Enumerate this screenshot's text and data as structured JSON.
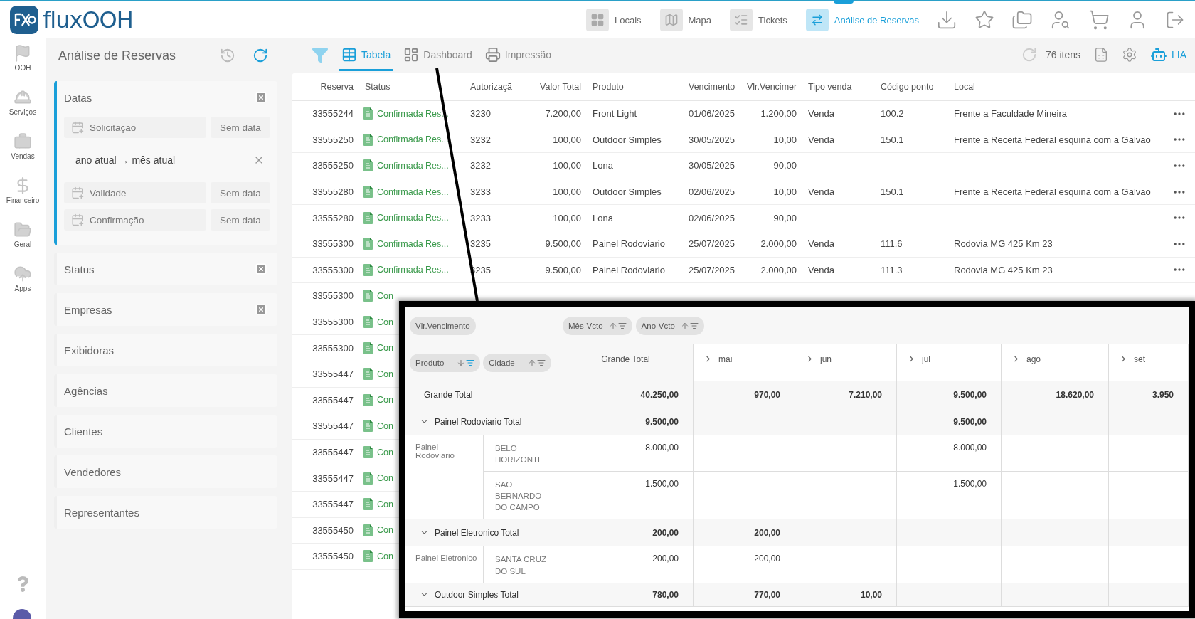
{
  "brand": {
    "name": "fluxOOH"
  },
  "top_nav": [
    {
      "label": "Locais",
      "kind": "grid",
      "selected": false
    },
    {
      "label": "Mapa",
      "kind": "map",
      "selected": false
    },
    {
      "label": "Tickets",
      "kind": "list",
      "selected": false
    },
    {
      "label": "Análise de Reservas",
      "kind": "analysis",
      "selected": true
    }
  ],
  "rail": [
    {
      "label": "OOH",
      "kind": "flag"
    },
    {
      "label": "Serviços",
      "kind": "helmet"
    },
    {
      "label": "Vendas",
      "kind": "briefcase"
    },
    {
      "label": "Financeiro",
      "kind": "money"
    },
    {
      "label": "Geral",
      "kind": "folder"
    },
    {
      "label": "Apps",
      "kind": "cloud"
    }
  ],
  "filter_panel": {
    "title": "Análise de Reservas",
    "sections": [
      {
        "label": "Datas",
        "expanded": true,
        "clearable": true,
        "fields": [
          {
            "kind": "date",
            "label": "Solicitação",
            "value": "Sem data"
          },
          {
            "kind": "range",
            "text": "ano atual → mês atual"
          },
          {
            "kind": "date",
            "label": "Validade",
            "value": "Sem data"
          },
          {
            "kind": "date",
            "label": "Confirmação",
            "value": "Sem data"
          }
        ]
      },
      {
        "label": "Status",
        "expanded": false,
        "clearable": true
      },
      {
        "label": "Empresas",
        "expanded": false,
        "clearable": true
      },
      {
        "label": "Exibidoras",
        "expanded": false,
        "clearable": false
      },
      {
        "label": "Agências",
        "expanded": false,
        "clearable": false
      },
      {
        "label": "Clientes",
        "expanded": false,
        "clearable": false
      },
      {
        "label": "Vendedores",
        "expanded": false,
        "clearable": false
      },
      {
        "label": "Representantes",
        "expanded": false,
        "clearable": false
      }
    ]
  },
  "toolbar": {
    "tabs": [
      {
        "label": "Tabela",
        "kind": "table",
        "selected": true
      },
      {
        "label": "Dashboard",
        "kind": "dashboard",
        "selected": false
      },
      {
        "label": "Impressão",
        "kind": "print",
        "selected": false
      }
    ],
    "count": "76 itens",
    "assistant": "LIA"
  },
  "table": {
    "columns": [
      "Reserva",
      "Status",
      "Autorizaçã",
      "Valor Total",
      "Produto",
      "Vencimento",
      "Vlr.Vencimer",
      "Tipo venda",
      "Código ponto",
      "Local"
    ],
    "rows": [
      {
        "reserva": "33555244",
        "status": "Confirmada Res...",
        "autorizacao": "3230",
        "valor_total": "7.200,00",
        "produto": "Front Light",
        "vencimento": "01/06/2025",
        "vlr_vencimento": "1.200,00",
        "tipo_venda": "Venda",
        "codigo_ponto": "100.2",
        "local": "Frente a Faculdade Mineira"
      },
      {
        "reserva": "33555250",
        "status": "Confirmada Res...",
        "autorizacao": "3232",
        "valor_total": "100,00",
        "produto": "Outdoor Simples",
        "vencimento": "30/05/2025",
        "vlr_vencimento": "10,00",
        "tipo_venda": "Venda",
        "codigo_ponto": "150.1",
        "local": "Frente a Receita Federal esquina com a Galvão"
      },
      {
        "reserva": "33555250",
        "status": "Confirmada Res...",
        "autorizacao": "3232",
        "valor_total": "100,00",
        "produto": "Lona",
        "vencimento": "30/05/2025",
        "vlr_vencimento": "90,00"
      },
      {
        "reserva": "33555280",
        "status": "Confirmada Res...",
        "autorizacao": "3233",
        "valor_total": "100,00",
        "produto": "Outdoor Simples",
        "vencimento": "02/06/2025",
        "vlr_vencimento": "10,00",
        "tipo_venda": "Venda",
        "codigo_ponto": "150.1",
        "local": "Frente a Receita Federal esquina com a Galvão"
      },
      {
        "reserva": "33555280",
        "status": "Confirmada Res...",
        "autorizacao": "3233",
        "valor_total": "100,00",
        "produto": "Lona",
        "vencimento": "02/06/2025",
        "vlr_vencimento": "90,00"
      },
      {
        "reserva": "33555300",
        "status": "Confirmada Res...",
        "autorizacao": "3235",
        "valor_total": "9.500,00",
        "produto": "Painel Rodoviario",
        "vencimento": "25/07/2025",
        "vlr_vencimento": "2.000,00",
        "tipo_venda": "Venda",
        "codigo_ponto": "111.6",
        "local": "Rodovia MG 425 Km 23"
      },
      {
        "reserva": "33555300",
        "status": "Confirmada Res...",
        "autorizacao": "3235",
        "valor_total": "9.500,00",
        "produto": "Painel Rodoviario",
        "vencimento": "25/07/2025",
        "vlr_vencimento": "2.000,00",
        "tipo_venda": "Venda",
        "codigo_ponto": "111.3",
        "local": "Rodovia MG 425 Km 23"
      },
      {
        "reserva": "33555300",
        "status": "Con"
      },
      {
        "reserva": "33555300",
        "status": "Con"
      },
      {
        "reserva": "33555300",
        "status": "Con"
      },
      {
        "reserva": "33555447",
        "status": "Con"
      },
      {
        "reserva": "33555447",
        "status": "Con"
      },
      {
        "reserva": "33555447",
        "status": "Con"
      },
      {
        "reserva": "33555447",
        "status": "Con"
      },
      {
        "reserva": "33555447",
        "status": "Con"
      },
      {
        "reserva": "33555447",
        "status": "Con"
      },
      {
        "reserva": "33555450",
        "status": "Con"
      },
      {
        "reserva": "33555450",
        "status": "Con"
      }
    ]
  },
  "pivot": {
    "value_field": "Vlr.Vencimento",
    "column_fields": [
      {
        "label": "Mês-Vcto",
        "descending": false,
        "filtered": false
      },
      {
        "label": "Ano-Vcto",
        "descending": false,
        "filtered": false
      }
    ],
    "row_fields": [
      {
        "label": "Produto",
        "descending": true,
        "filtered": true
      },
      {
        "label": "Cidade",
        "descending": false,
        "filtered": false
      }
    ],
    "columns": [
      {
        "label": "Grande Total",
        "expandable": false
      },
      {
        "label": "mai",
        "expandable": true
      },
      {
        "label": "jun",
        "expandable": true
      },
      {
        "label": "jul",
        "expandable": true
      },
      {
        "label": "ago",
        "expandable": true
      },
      {
        "label": "set",
        "expandable": true
      }
    ],
    "grand_total": {
      "label": "Grande Total",
      "values": {
        "grande_total": "40.250,00",
        "mai": "970,00",
        "jun": "7.210,00",
        "jul": "9.500,00",
        "ago": "18.620,00",
        "set": "3.950"
      }
    },
    "groups": [
      {
        "label": "Painel Rodoviario Total",
        "expanded": true,
        "values": {
          "grande_total": "9.500,00",
          "jul": "9.500,00"
        },
        "product": "Painel Rodoviario",
        "cities": [
          {
            "label": "BELO HORIZONTE",
            "values": {
              "grande_total": "8.000,00",
              "jul": "8.000,00"
            }
          },
          {
            "label": "SAO BERNARDO DO CAMPO",
            "values": {
              "grande_total": "1.500,00",
              "jul": "1.500,00"
            }
          }
        ]
      },
      {
        "label": "Painel Eletronico Total",
        "expanded": true,
        "values": {
          "grande_total": "200,00",
          "mai": "200,00"
        },
        "product": "Painel Eletronico",
        "cities": [
          {
            "label": "SANTA CRUZ DO SUL",
            "values": {
              "grande_total": "200,00",
              "mai": "200,00"
            }
          }
        ]
      },
      {
        "label": "Outdoor Simples Total",
        "expanded": true,
        "values": {
          "grande_total": "780,00",
          "mai": "770,00",
          "jun": "10,00"
        }
      }
    ]
  }
}
